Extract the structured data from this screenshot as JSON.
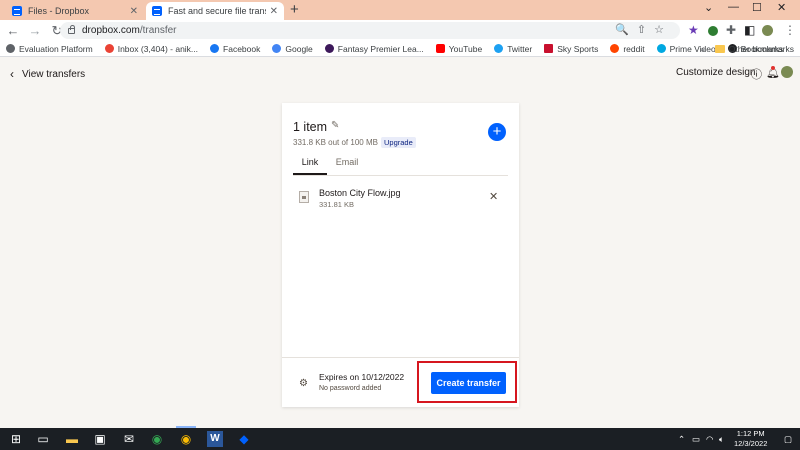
{
  "browser": {
    "tabs": [
      {
        "title": "Files - Dropbox",
        "active": false
      },
      {
        "title": "Fast and secure file transfer - Dro",
        "active": true
      }
    ],
    "new_tab_label": "+",
    "window_controls": [
      "⌄",
      "—",
      "☐",
      "✕"
    ],
    "url_host": "dropbox.com",
    "url_path": "/transfer",
    "bookmarks": [
      {
        "label": "Evaluation Platform",
        "color": "#5f6368"
      },
      {
        "label": "Inbox (3,404) - anik...",
        "color": "#ea4335"
      },
      {
        "label": "Facebook",
        "color": "#1877f2"
      },
      {
        "label": "Google",
        "color": "#4285f4"
      },
      {
        "label": "Fantasy Premier Lea...",
        "color": "#3d195b"
      },
      {
        "label": "YouTube",
        "color": "#ff0000"
      },
      {
        "label": "Twitter",
        "color": "#1da1f2"
      },
      {
        "label": "Sky Sports",
        "color": "#c8102e"
      },
      {
        "label": "reddit",
        "color": "#ff4500"
      },
      {
        "label": "Prime Video",
        "color": "#00a8e1"
      },
      {
        "label": "Bookmarks",
        "color": "#202124"
      }
    ],
    "other_bookmarks": "Other bookmarks"
  },
  "header": {
    "back_label": "View transfers",
    "customize_label": "Customize design"
  },
  "card": {
    "title": "1 item",
    "capacity": "331.8 KB out of 100 MB",
    "upgrade": "Upgrade",
    "tabs": [
      "Link",
      "Email"
    ],
    "file": {
      "name": "Boston City Flow.jpg",
      "size": "331.81 KB"
    },
    "expires": "Expires on 10/12/2022",
    "password": "No password added",
    "create_label": "Create transfer"
  },
  "taskbar": {
    "time": "1:12 PM",
    "date": "12/3/2022"
  },
  "colors": {
    "accent": "#0061fe",
    "highlight": "#d6161f",
    "tab_strip": "#f4c8b0"
  }
}
